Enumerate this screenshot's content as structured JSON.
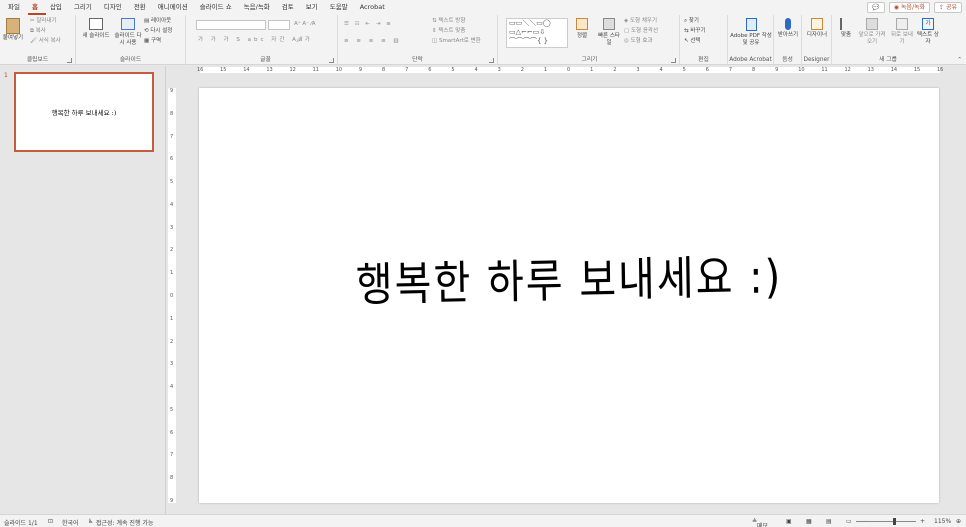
{
  "tabs": [
    "파일",
    "홈",
    "삽입",
    "그리기",
    "디자인",
    "전환",
    "애니메이션",
    "슬라이드 쇼",
    "녹음/녹화",
    "검토",
    "보기",
    "도움말",
    "Acrobat"
  ],
  "tabs_active_index": 1,
  "top_right": {
    "record": "녹음/녹화",
    "share": "공유"
  },
  "ribbon": {
    "clipboard": {
      "label": "클립보드",
      "paste": "붙여넣기",
      "cut": "잘라내기",
      "copy": "복사",
      "format_painter": "서식 복사"
    },
    "slides": {
      "label": "슬라이드",
      "new_slide": "새 슬라이드",
      "reuse_slide": "슬라이드 다시 사용",
      "layout": "레이아웃",
      "reset": "다시 설정",
      "section": "구역"
    },
    "font": {
      "label": "글꼴"
    },
    "paragraph": {
      "label": "단락",
      "text_direction": "텍스트 방향",
      "align_text": "텍스트 맞춤",
      "smartart": "SmartArt로 변환"
    },
    "drawing": {
      "label": "그리기",
      "arrange": "정렬",
      "quick_styles": "빠른 스타일",
      "shape_fill": "도형 채우기",
      "shape_outline": "도형 윤곽선",
      "shape_effects": "도형 효과"
    },
    "editing": {
      "label": "편집",
      "find": "찾기",
      "replace": "바꾸기",
      "select": "선택"
    },
    "acrobat": {
      "label": "Adobe Acrobat",
      "create_pdf": "Adobe PDF 작성 및 공유"
    },
    "voice": {
      "label": "음성",
      "dictate": "받아쓰기"
    },
    "designer": {
      "label": "Designer",
      "design_ideas": "디자이너"
    },
    "new_group": {
      "label": "새 그룹",
      "align": "맞춤",
      "bring_forward": "앞으로 가져오기",
      "send_backward": "뒤로 보내기",
      "text_box": "텍스트 상자"
    }
  },
  "ruler_h": [
    "16",
    "15",
    "14",
    "13",
    "12",
    "11",
    "10",
    "9",
    "8",
    "7",
    "6",
    "5",
    "4",
    "3",
    "2",
    "1",
    "0",
    "1",
    "2",
    "3",
    "4",
    "5",
    "6",
    "7",
    "8",
    "9",
    "10",
    "11",
    "12",
    "13",
    "14",
    "15",
    "16"
  ],
  "ruler_v": [
    "9",
    "8",
    "7",
    "6",
    "5",
    "4",
    "3",
    "2",
    "1",
    "0",
    "1",
    "2",
    "3",
    "4",
    "5",
    "6",
    "7",
    "8",
    "9"
  ],
  "thumbnail": {
    "number": "1",
    "text": "행복한 하루 보내세요 :)"
  },
  "slide": {
    "text": "행복한 하루 보내세요 :)"
  },
  "status": {
    "slide_count": "슬라이드 1/1",
    "language": "한국어",
    "accessibility": "접근성: 계속 진행 가능",
    "notes": "메모",
    "zoom": "115%"
  },
  "colors": {
    "accent": "#b7472a"
  }
}
